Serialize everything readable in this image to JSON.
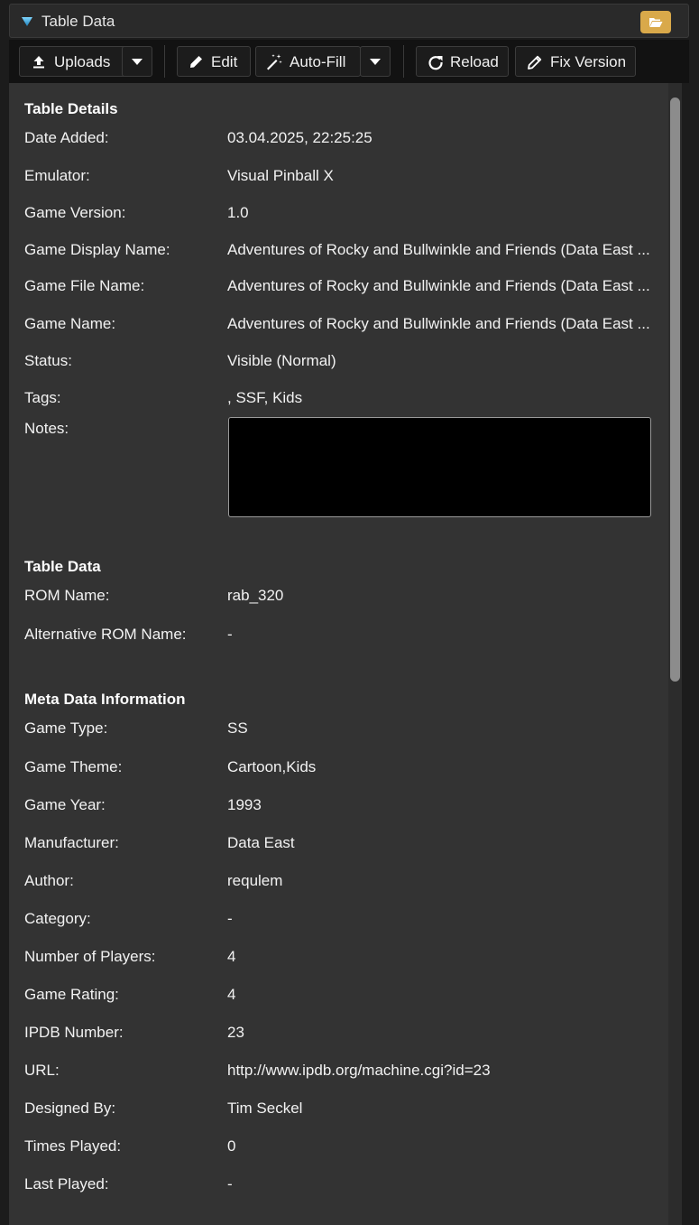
{
  "panel_title": "Table Data",
  "toolbar": {
    "uploads_label": "Uploads",
    "edit_label": "Edit",
    "autofill_label": "Auto-Fill",
    "reload_label": "Reload",
    "fix_version_label": "Fix Version"
  },
  "table_details": {
    "heading": "Table Details",
    "rows": [
      {
        "label": "Date Added:",
        "value": "03.04.2025, 22:25:25"
      },
      {
        "label": "Emulator:",
        "value": "Visual Pinball X"
      },
      {
        "label": "Game Version:",
        "value": "1.0"
      },
      {
        "label": "Game Display Name:",
        "value": "Adventures of Rocky and Bullwinkle and Friends (Data East ..."
      },
      {
        "label": "Game File Name:",
        "value": "Adventures of Rocky and Bullwinkle and Friends (Data East ..."
      },
      {
        "label": "Game Name:",
        "value": "Adventures of Rocky and Bullwinkle and Friends (Data East ..."
      },
      {
        "label": "Status:",
        "value": "Visible (Normal)"
      },
      {
        "label": "Tags:",
        "value": ", SSF, Kids"
      }
    ],
    "notes_label": "Notes:",
    "notes_value": ""
  },
  "table_data": {
    "heading": "Table Data",
    "rows": [
      {
        "label": "ROM Name:",
        "value": "rab_320"
      },
      {
        "label": "Alternative ROM Name:",
        "value": "-"
      }
    ]
  },
  "meta_data": {
    "heading": "Meta Data Information",
    "rows": [
      {
        "label": "Game Type:",
        "value": "SS"
      },
      {
        "label": "Game Theme:",
        "value": "Cartoon,Kids"
      },
      {
        "label": "Game Year:",
        "value": "1993"
      },
      {
        "label": "Manufacturer:",
        "value": "Data East"
      },
      {
        "label": "Author:",
        "value": "requlem"
      },
      {
        "label": "Category:",
        "value": "-"
      },
      {
        "label": "Number of Players:",
        "value": "4"
      },
      {
        "label": "Game Rating:",
        "value": "4"
      },
      {
        "label": "IPDB Number:",
        "value": "23"
      },
      {
        "label": "URL:",
        "value": "http://www.ipdb.org/machine.cgi?id=23"
      },
      {
        "label": "Designed By:",
        "value": "Tim Seckel"
      },
      {
        "label": "Times Played:",
        "value": "0"
      },
      {
        "label": "Last Played:",
        "value": "-"
      }
    ]
  },
  "colors": {
    "accent_folder": "#d9a94a",
    "panel_bg": "#333333",
    "toolbar_bg": "#121212"
  }
}
